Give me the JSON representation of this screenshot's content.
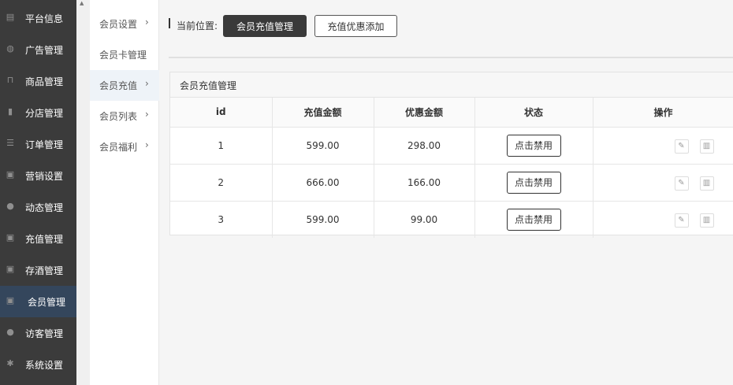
{
  "sidebar": {
    "items": [
      {
        "label": "平台信息",
        "icon": "monitor-icon"
      },
      {
        "label": "广告管理",
        "icon": "globe-icon"
      },
      {
        "label": "商品管理",
        "icon": "cart-icon"
      },
      {
        "label": "分店管理",
        "icon": "book-icon"
      },
      {
        "label": "订单管理",
        "icon": "list-icon"
      },
      {
        "label": "营销设置",
        "icon": "gift-icon"
      },
      {
        "label": "动态管理",
        "icon": "user-icon"
      },
      {
        "label": "充值管理",
        "icon": "gift-icon"
      },
      {
        "label": "存酒管理",
        "icon": "gift-icon"
      },
      {
        "label": "会员管理",
        "icon": "gift-icon",
        "active": true
      },
      {
        "label": "访客管理",
        "icon": "user-icon"
      },
      {
        "label": "系统设置",
        "icon": "gear-icon"
      }
    ]
  },
  "submenu": {
    "items": [
      {
        "label": "会员设置",
        "chevron": true
      },
      {
        "label": "会员卡管理",
        "chevron": false
      },
      {
        "label": "会员充值",
        "chevron": true,
        "active": true
      },
      {
        "label": "会员列表",
        "chevron": true
      },
      {
        "label": "会员福利",
        "chevron": true
      }
    ]
  },
  "breadcrumb": {
    "label": "当前位置:",
    "current": "会员充值管理",
    "add_button": "充值优惠添加"
  },
  "panel": {
    "title": "会员充值管理"
  },
  "table": {
    "headers": [
      "id",
      "充值金额",
      "优惠金额",
      "状态",
      "操作"
    ],
    "rows": [
      {
        "id": "1",
        "amount": "599.00",
        "discount": "298.00",
        "status": "点击禁用"
      },
      {
        "id": "2",
        "amount": "666.00",
        "discount": "166.00",
        "status": "点击禁用"
      },
      {
        "id": "3",
        "amount": "599.00",
        "discount": "99.00",
        "status": "点击禁用"
      }
    ]
  }
}
